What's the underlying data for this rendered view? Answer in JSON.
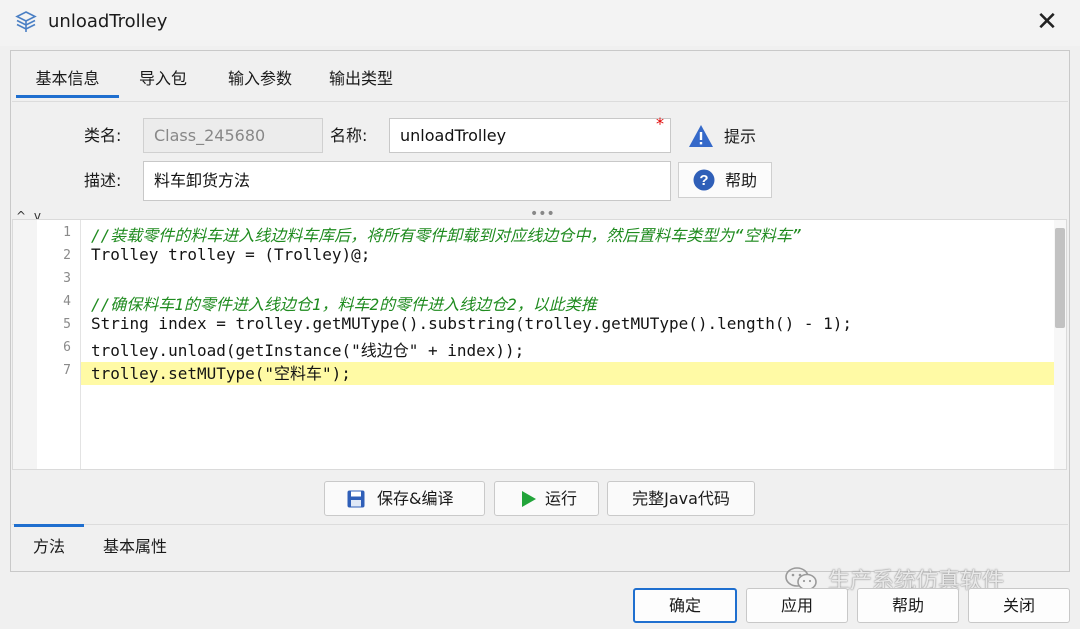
{
  "window": {
    "title": "unloadTrolley",
    "close_glyph": "✕"
  },
  "tabs": [
    "基本信息",
    "导入包",
    "输入参数",
    "输出类型"
  ],
  "form": {
    "class_label": "类名:",
    "class_value": "Class_245680",
    "name_label": "名称:",
    "name_value": "unloadTrolley",
    "required_mark": "*",
    "desc_label": "描述:",
    "desc_value": "料车卸货方法",
    "hint_label": "提示",
    "help_label": "帮助"
  },
  "editor": {
    "splitter_arrows": "^ v",
    "grip": "•••",
    "line_numbers": [
      "1",
      "2",
      "3",
      "4",
      "5",
      "6",
      "7"
    ],
    "lines": [
      "//装载零件的料车进入线边料车库后，将所有零件卸载到对应线边仓中，然后置料车类型为“空料车”",
      "Trolley trolley = (Trolley)@;",
      "",
      "//确保料车1的零件进入线边仓1，料车2的零件进入线边仓2，以此类推",
      "String index = trolley.getMUType().substring(trolley.getMUType().length() - 1);",
      "trolley.unload(getInstance(\"线边仓\" + index));",
      "trolley.setMUType(\"空料车\");"
    ],
    "highlighted_line": 7
  },
  "actions": {
    "save": "保存&编译",
    "run": "运行",
    "full_java": "完整Java代码"
  },
  "bottom_tabs": [
    "方法",
    "基本属性"
  ],
  "footer": {
    "ok": "确定",
    "apply": "应用",
    "help": "帮助",
    "close": "关闭"
  },
  "watermark": "生产系统仿真软件",
  "colors": {
    "accent": "#1f6fcf",
    "required": "#e00000",
    "comment": "#1f8b1f",
    "string": "#d11fc4",
    "highlight": "#fffaa5"
  },
  "icons": [
    "cube-stack-icon",
    "close-icon",
    "warning-icon",
    "help-circle-icon",
    "save-disk-icon",
    "play-icon",
    "wechat-icon"
  ]
}
